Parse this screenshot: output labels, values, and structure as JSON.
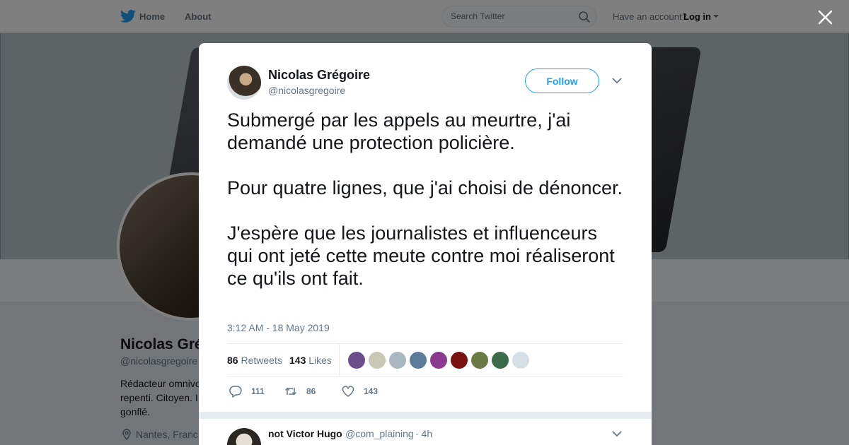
{
  "nav": {
    "home_label": "Home",
    "about_label": "About",
    "search_placeholder": "Search Twitter",
    "have_account": "Have an account?",
    "login_label": "Log in"
  },
  "background_profile": {
    "name": "Nicolas Gré",
    "handle": "@nicolasgregoire",
    "bio": "Rédacteur omnivo repenti. Citoyen. I gonflé.",
    "location": "Nantes, Franc"
  },
  "tweet": {
    "author_name": "Nicolas Grégoire",
    "author_handle": "@nicolasgregoire",
    "follow_label": "Follow",
    "paragraphs": [
      "Submergé par les appels au meurtre, j'ai demandé une protection policière.",
      "Pour quatre lignes, que j'ai choisi de dénoncer.",
      "J'espère que les journalistes et influenceurs qui ont jeté cette meute contre moi réaliseront ce qu'ils ont fait."
    ],
    "timestamp": "3:12 AM - 18 May 2019",
    "retweets_count": "86",
    "retweets_label": "Retweets",
    "likes_count": "143",
    "likes_label": "Likes",
    "reply_action_count": "111",
    "retweet_action_count": "86",
    "like_action_count": "143"
  },
  "likers": [
    {
      "color": "#6b4f8a"
    },
    {
      "color": "#c8c8b4"
    },
    {
      "color": "#aab8c2"
    },
    {
      "color": "#5c7a99"
    },
    {
      "color": "#8a3b8f"
    },
    {
      "color": "#7a1010"
    },
    {
      "color": "#6b7a45"
    },
    {
      "color": "#3a6b4a"
    },
    {
      "color": "#d7dfe6"
    }
  ],
  "reply": {
    "name": "not Victor Hugo",
    "handle": "@com_plaining",
    "time": "· 4h"
  },
  "colors": {
    "brand_blue": "#1da1f2",
    "secondary_text": "#657786",
    "background": "#e6ecf0"
  }
}
